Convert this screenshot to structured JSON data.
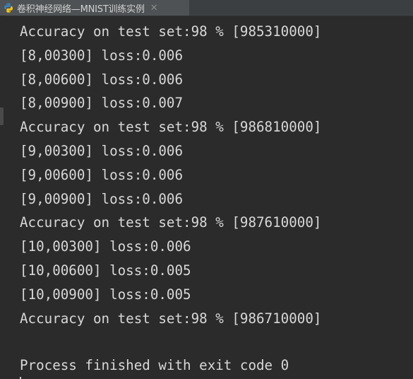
{
  "tab": {
    "title": "卷积神经网络—MNIST训练实例",
    "icon": "python-icon",
    "close_glyph": "✕"
  },
  "console": {
    "lines": [
      "Accuracy on test set:98 % [985310000]",
      "[8,00300] loss:0.006",
      "[8,00600] loss:0.006",
      "[8,00900] loss:0.007",
      "Accuracy on test set:98 % [986810000]",
      "[9,00300] loss:0.006",
      "[9,00600] loss:0.006",
      "[9,00900] loss:0.006",
      "Accuracy on test set:98 % [987610000]",
      "[10,00300] loss:0.006",
      "[10,00600] loss:0.005",
      "[10,00900] loss:0.005",
      "Accuracy on test set:98 % [986710000]"
    ],
    "exit_message": "Process finished with exit code 0"
  },
  "colors": {
    "background": "#2b2b2b",
    "text": "#d8d8d8",
    "tab_active": "#4e5254"
  }
}
